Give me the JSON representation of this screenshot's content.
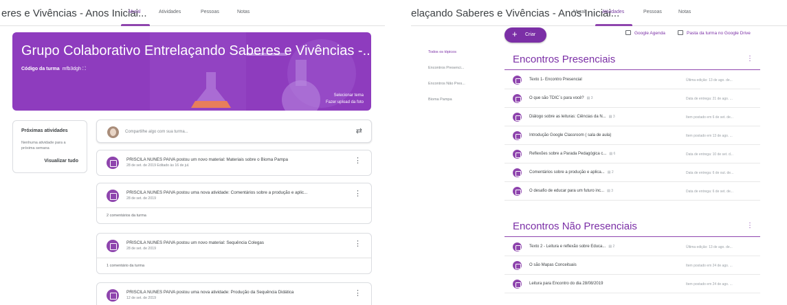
{
  "left": {
    "class_title": "eres e Vivências - Anos Iniciai...",
    "tabs": [
      "Mural",
      "Atividades",
      "Pessoas",
      "Notas"
    ],
    "banner": {
      "title": "Grupo Colaborativo Entrelaçando Saberes e Vivências -...",
      "code_label": "Código da turma",
      "code_value": "mfb3dgh",
      "select_theme": "Selecionar tema",
      "upload_photo": "Fazer upload da foto"
    },
    "upcoming": {
      "title": "Próximas atividades",
      "empty": "Nenhuma atividade para a próxima semana",
      "view_all": "Visualizar tudo"
    },
    "share_placeholder": "Compartilhe algo com sua turma...",
    "posts": [
      {
        "title": "PRISCILA NUNES PAIVA postou um novo material: Materiais sobre o Bioma Pampa",
        "date": "28 de set. de 2019 Editado às 16 de jul.",
        "comments": ""
      },
      {
        "title": "PRISCILA NUNES PAIVA postou uma nova atividade: Comentários sobre a produção e aplic...",
        "date": "28 de set. de 2019",
        "comments": "2 comentários da turma"
      },
      {
        "title": "PRISCILA NUNES PAIVA postou um novo material: Sequência Colegas",
        "date": "28 de set. de 2019",
        "comments": "1 comentário da turma"
      },
      {
        "title": "PRISCILA NUNES PAIVA postou uma nova atividade: Produção da Sequência Didática",
        "date": "12 de set. de 2019",
        "comments": ""
      }
    ]
  },
  "right": {
    "class_title": "elaçando Saberes e Vivências - Anos Iniciai...",
    "tabs": [
      "Mural",
      "Atividades",
      "Pessoas",
      "Notas"
    ],
    "create_label": "Criar",
    "plus": "+",
    "calendar_link": "Google Agenda",
    "drive_link": "Pasta da turma no Google Drive",
    "topics": [
      "Todos os tópicos",
      "Encontros Presenci...",
      "Encontros Não Pres...",
      "Bioma Pampa"
    ],
    "sections": [
      {
        "title": "Encontros Presenciais",
        "items": [
          {
            "title": "Texto 1- Encontro Presencial",
            "comments": "",
            "meta": "Última edição: 13 de ago. de..."
          },
          {
            "title": "O que são TDIC´s para você?",
            "comments": "3",
            "meta": "Data de entrega: 21 de ago. ..."
          },
          {
            "title": "Diálogo sobre as leituras: Ciências da N...",
            "comments": "3",
            "meta": "Item postado em 6 de set. de..."
          },
          {
            "title": "Introdução Google Classroom ( sala de aula)",
            "comments": "",
            "meta": "Item postado em 13 de ago. ..."
          },
          {
            "title": "Reflexões sobre a Parada Pedagógica c...",
            "comments": "6",
            "meta": "Data de entrega: 10 de set. d..."
          },
          {
            "title": "Comentários sobre a produção e aplica...",
            "comments": "2",
            "meta": "Data de entrega: 6 de out. de..."
          },
          {
            "title": "O desafio de educar para um futuro inc...",
            "comments": "3",
            "meta": "Data de entrega: 6 de set. de..."
          }
        ]
      },
      {
        "title": "Encontros Não Presenciais",
        "items": [
          {
            "title": "Texto 2 - Leitura e reflexão sobre Educa...",
            "comments": "2",
            "meta": "Última edição: 13 de ago. de..."
          },
          {
            "title": "O são Mapas Conceituais",
            "comments": "",
            "meta": "Item postado em 24 de ago. ..."
          },
          {
            "title": "Leitura para Encontro do dia 28/08/2019",
            "comments": "",
            "meta": "Item postado em 24 de ago. ..."
          }
        ]
      }
    ]
  },
  "icons": {
    "kebab": "⋮",
    "repost": "⇄",
    "expand": "⛶",
    "comment": "▤"
  },
  "colors": {
    "accent": "#8e44ad",
    "banner": "#8e3cbe"
  }
}
